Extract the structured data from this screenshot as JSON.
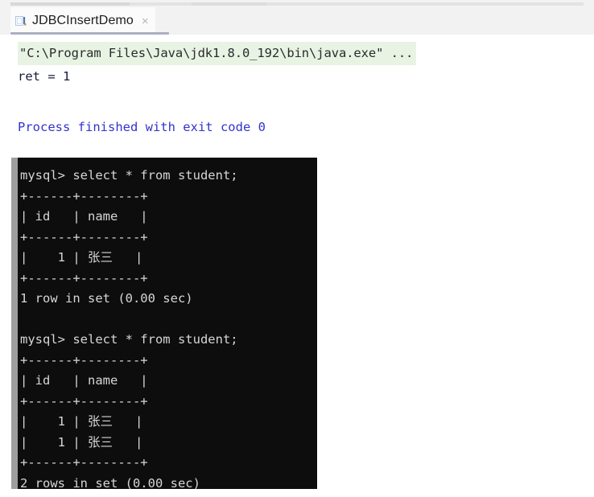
{
  "window": {
    "background_color": "#ffffff"
  },
  "tab_bar": {
    "active_tab": {
      "label": "JDBCInsertDemo",
      "icon": "run-configuration-icon",
      "close_label": "×"
    },
    "underline_color": "#aab0c0"
  },
  "console": {
    "command_line": "\"C:\\Program Files\\Java\\jdk1.8.0_192\\bin\\java.exe\" ...",
    "output_line": "ret = 1",
    "exit_line": "Process finished with exit code 0",
    "command_highlight_color": "#e8f3e4",
    "exit_text_color": "#3333cc"
  },
  "terminal": {
    "background_color": "#0d0d0d",
    "text_color": "#d6d6d6",
    "lines": [
      "mysql> select * from student;",
      "+------+--------+",
      "| id   | name   |",
      "+------+--------+",
      "|    1 | 张三   |",
      "+------+--------+",
      "1 row in set (0.00 sec)",
      "",
      "mysql> select * from student;",
      "+------+--------+",
      "| id   | name   |",
      "+------+--------+",
      "|    1 | 张三   |",
      "|    1 | 张三   |",
      "+------+--------+",
      "2 rows in set (0.00 sec)"
    ],
    "queries": [
      {
        "prompt": "mysql>",
        "sql": "select * from student;",
        "columns": [
          "id",
          "name"
        ],
        "rows": [
          [
            "1",
            "张三"
          ]
        ],
        "status": "1 row in set (0.00 sec)"
      },
      {
        "prompt": "mysql>",
        "sql": "select * from student;",
        "columns": [
          "id",
          "name"
        ],
        "rows": [
          [
            "1",
            "张三"
          ],
          [
            "1",
            "张三"
          ]
        ],
        "status": "2 rows in set (0.00 sec)"
      }
    ]
  }
}
